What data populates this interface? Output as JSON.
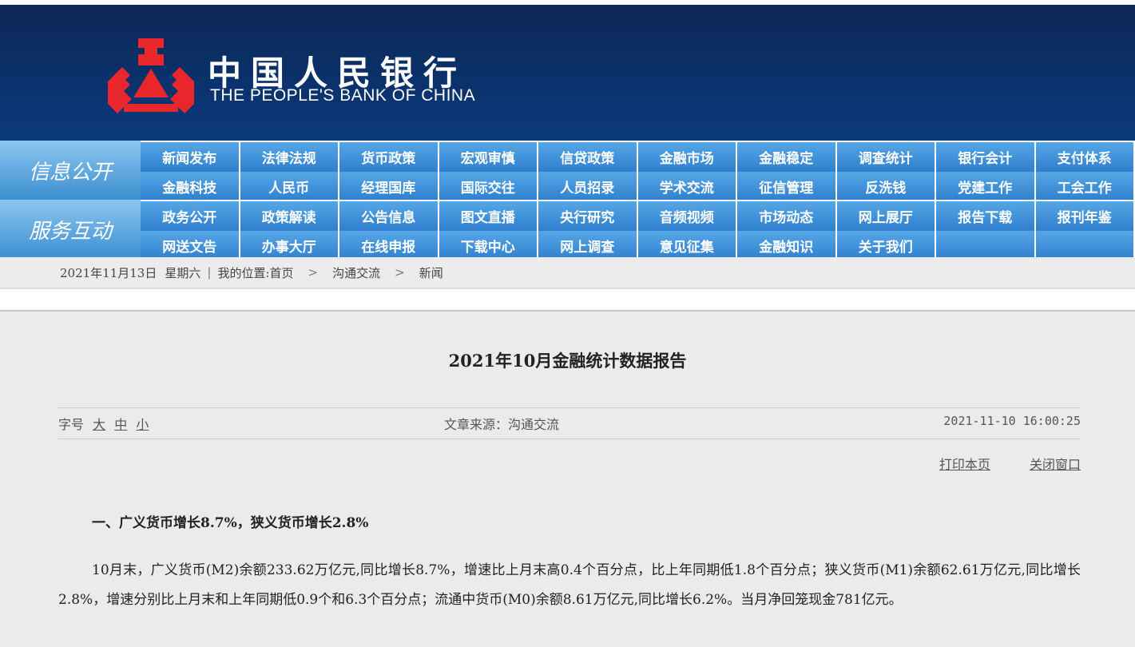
{
  "header": {
    "logo_cn": "中国人民银行",
    "logo_en": "THE PEOPLE'S BANK OF CHINA",
    "logo_color": "#e8262b",
    "background_color": "#0b2f66"
  },
  "nav_info": {
    "label": "信息公开",
    "items": [
      "新闻发布",
      "法律法规",
      "货币政策",
      "宏观审慎",
      "信贷政策",
      "金融市场",
      "金融稳定",
      "调查统计",
      "银行会计",
      "支付体系",
      "金融科技",
      "人民币",
      "经理国库",
      "国际交往",
      "人员招录",
      "学术交流",
      "征信管理",
      "反洗钱",
      "党建工作",
      "工会工作"
    ]
  },
  "nav_service": {
    "label": "服务互动",
    "items": [
      "政务公开",
      "政策解读",
      "公告信息",
      "图文直播",
      "央行研究",
      "音频视频",
      "市场动态",
      "网上展厅",
      "报告下载",
      "报刊年鉴",
      "网送文告",
      "办事大厅",
      "在线申报",
      "下载中心",
      "网上调查",
      "意见征集",
      "金融知识",
      "关于我们"
    ]
  },
  "breadcrumb": {
    "date": "2021年11月13日",
    "weekday": "星期六",
    "pipe": "|",
    "location_label": "我的位置:",
    "home": "首页",
    "sep": ">",
    "level1": "沟通交流",
    "level2": "新闻"
  },
  "article": {
    "title": "2021年10月金融统计数据报告",
    "font_size_label": "字号",
    "font_large": "大",
    "font_medium": "中",
    "font_small": "小",
    "source": "文章来源：沟通交流",
    "datetime": "2021-11-10 16:00:25",
    "print_label": "打印本页",
    "close_label": "关闭窗口",
    "section1_title": "一、广义货币增长8.7%，狭义货币增长2.8%",
    "section1_para": "10月末，广义货币(M2)余额233.62万亿元,同比增长8.7%，增速比上月末高0.4个百分点，比上年同期低1.8个百分点；狭义货币(M1)余额62.61万亿元,同比增长2.8%，增速分别比上月末和上年同期低0.9个和6.3个百分点；流通中货币(M0)余额8.61万亿元,同比增长6.2%。当月净回笼现金781亿元。"
  }
}
